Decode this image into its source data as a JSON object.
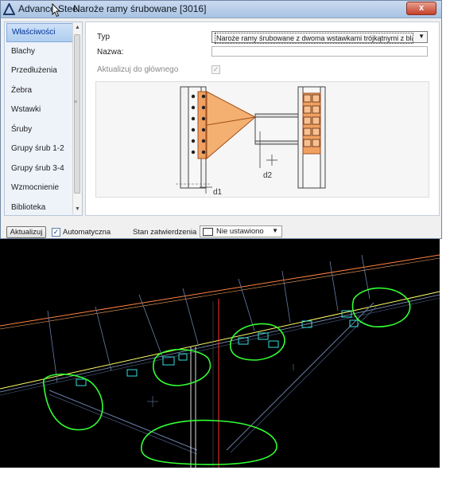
{
  "window": {
    "app_name": "Advance Steel",
    "document_title": "Naroże ramy śrubowane [3016]",
    "close_label": "x"
  },
  "sidebar": {
    "items": [
      {
        "label": "Właściwości",
        "active": true
      },
      {
        "label": "Blachy"
      },
      {
        "label": "Przedłużenia"
      },
      {
        "label": "Żebra"
      },
      {
        "label": "Wstawki"
      },
      {
        "label": "Śruby"
      },
      {
        "label": "Grupy śrub 1-2"
      },
      {
        "label": "Grupy śrub 3-4"
      },
      {
        "label": "Wzmocnienie"
      },
      {
        "label": "Biblioteka"
      }
    ]
  },
  "properties": {
    "type_label": "Typ",
    "type_value": "Naroże ramy śrubowane z dwoma wstawkami trójkątnymi z bla",
    "name_label": "Nazwa:",
    "name_value": "",
    "update_main_label": "Aktualizuj do głównego",
    "update_main_checked": true
  },
  "preview": {
    "dim_label_1": "d2",
    "dim_label_2": "d1",
    "accent_color": "#f0a060"
  },
  "bottom_bar": {
    "update_button": "Aktualizuj",
    "auto_label": "Automatyczna",
    "auto_checked": true,
    "approval_label": "Stan zatwierdzenia",
    "approval_value": "Nie ustawiono"
  },
  "viewport": {
    "background": "#000000",
    "annotation_color": "#33ff33",
    "member_color": "#ffff66",
    "grid_color": "#6a7fa8"
  }
}
